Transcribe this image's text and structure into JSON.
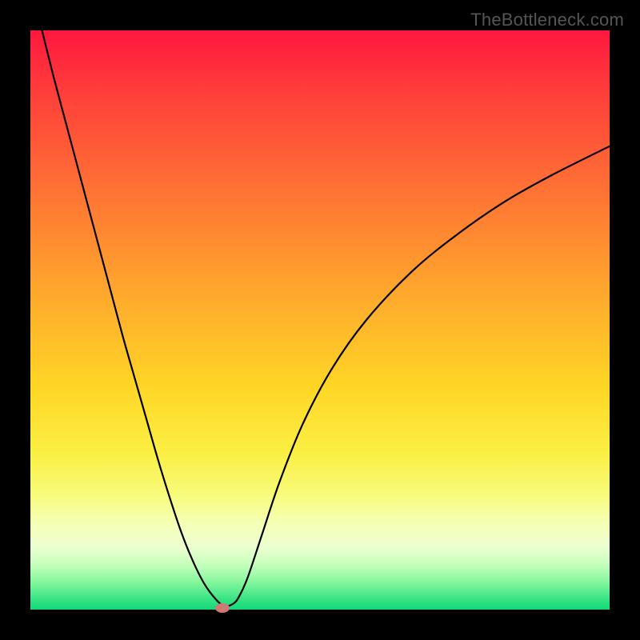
{
  "attribution": "TheBottleneck.com",
  "colors": {
    "curve": "#000000",
    "marker": "#cf7a74",
    "frame": "#000000"
  },
  "chart_data": {
    "type": "line",
    "title": "",
    "xlabel": "",
    "ylabel": "",
    "xlim": [
      0,
      100
    ],
    "ylim": [
      0,
      100
    ],
    "series": [
      {
        "name": "bottleneck-curve",
        "x": [
          0,
          2,
          4,
          6,
          8,
          10,
          12,
          14,
          16,
          18,
          20,
          22,
          24,
          26,
          28,
          30,
          32,
          33.5,
          35,
          36,
          37.5,
          40,
          43,
          47,
          52,
          58,
          66,
          74,
          82,
          90,
          100
        ],
        "y": [
          108,
          100,
          92,
          84.5,
          77,
          69.5,
          62,
          54.5,
          47,
          40,
          33,
          26,
          19.5,
          13.5,
          8.5,
          4.5,
          1.8,
          0.6,
          1.0,
          2.2,
          5.5,
          13,
          22,
          32,
          41.5,
          50,
          58.5,
          65,
          70.5,
          75,
          80
        ]
      }
    ],
    "marker": {
      "x": 33.2,
      "y": 0.3
    },
    "gradient_stops": [
      {
        "pos": 0,
        "color": "#ff173f"
      },
      {
        "pos": 10,
        "color": "#ff3c3b"
      },
      {
        "pos": 25,
        "color": "#ff6a35"
      },
      {
        "pos": 45,
        "color": "#ffa72d"
      },
      {
        "pos": 62,
        "color": "#ffd726"
      },
      {
        "pos": 73,
        "color": "#fbef44"
      },
      {
        "pos": 80,
        "color": "#f8fb7a"
      },
      {
        "pos": 85,
        "color": "#f5ffb4"
      },
      {
        "pos": 89,
        "color": "#eeffd0"
      },
      {
        "pos": 92,
        "color": "#c9ffbe"
      },
      {
        "pos": 95,
        "color": "#8bf8a0"
      },
      {
        "pos": 98,
        "color": "#3de586"
      },
      {
        "pos": 100,
        "color": "#12d97a"
      }
    ]
  }
}
